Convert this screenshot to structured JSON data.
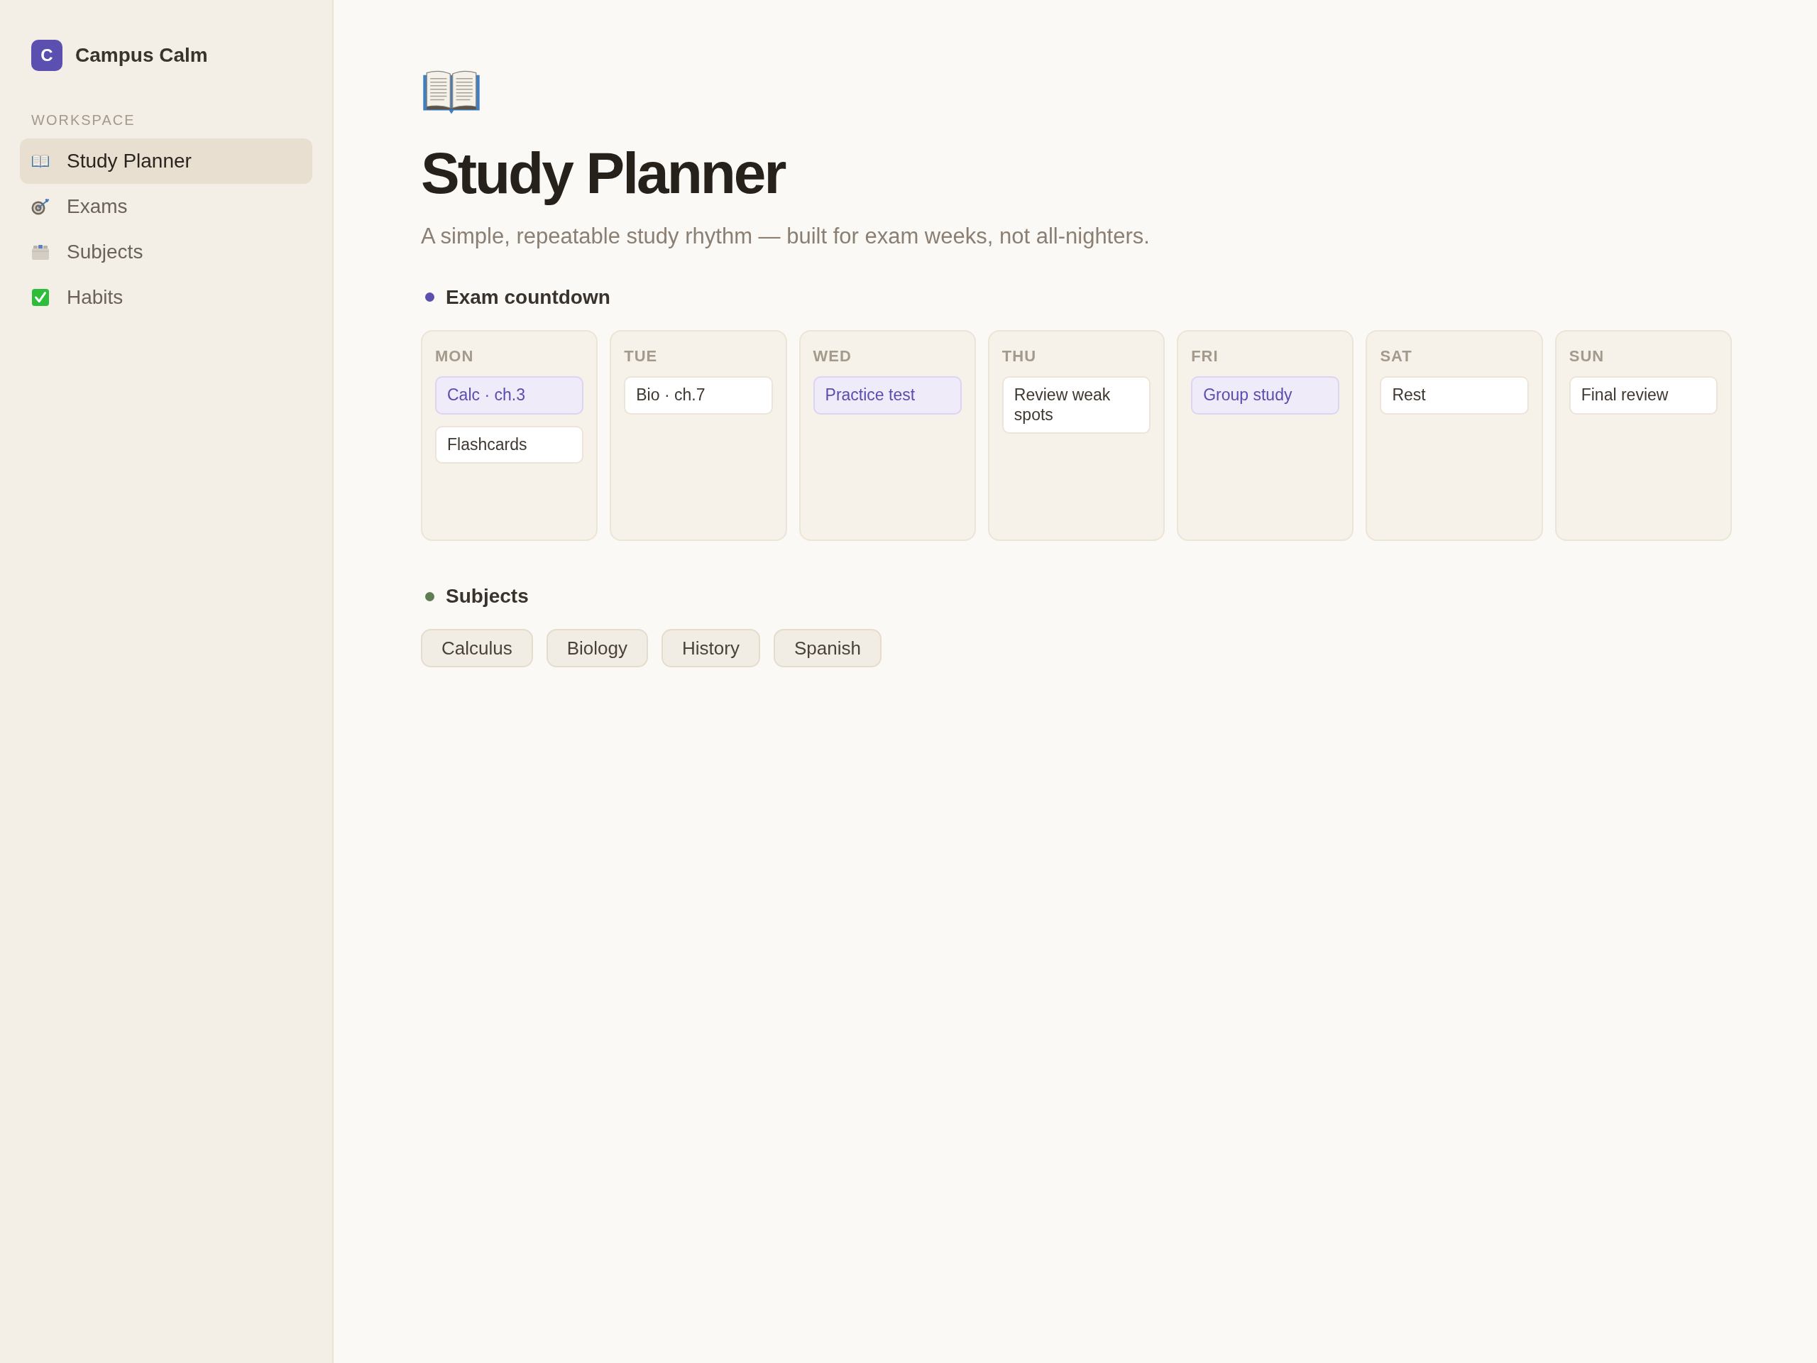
{
  "sidebar": {
    "brand": {
      "logo_letter": "C",
      "name": "Campus Calm"
    },
    "section_label": "WORKSPACE",
    "items": [
      {
        "label": "Study Planner",
        "selected": true
      },
      {
        "label": "Exams",
        "selected": false
      },
      {
        "label": "Subjects",
        "selected": false
      },
      {
        "label": "Habits",
        "selected": false
      }
    ]
  },
  "page": {
    "title": "Study Planner",
    "subtitle": "A simple, repeatable study rhythm — built for exam weeks, not all-nighters."
  },
  "sections": [
    {
      "kind": "week",
      "heading": "Exam countdown",
      "color": "#5b4fb0",
      "days": [
        {
          "label": "MON",
          "events": [
            {
              "text": "Calc · ch.3",
              "color": "#efebf9"
            },
            {
              "text": "Flashcards",
              "color": "#ffffff"
            }
          ]
        },
        {
          "label": "TUE",
          "events": [
            {
              "text": "Bio · ch.7",
              "color": "#ffffff"
            }
          ]
        },
        {
          "label": "WED",
          "events": [
            {
              "text": "Practice test",
              "color": "#efebf9"
            }
          ]
        },
        {
          "label": "THU",
          "events": [
            {
              "text": "Review weak spots",
              "color": "#ffffff"
            }
          ]
        },
        {
          "label": "FRI",
          "events": [
            {
              "text": "Group study",
              "color": "#efebf9"
            }
          ]
        },
        {
          "label": "SAT",
          "events": [
            {
              "text": "Rest",
              "color": "#ffffff"
            }
          ]
        },
        {
          "label": "SUN",
          "events": [
            {
              "text": "Final review",
              "color": "#ffffff"
            }
          ]
        }
      ]
    },
    {
      "kind": "tags",
      "heading": "Subjects",
      "color": "#5f7d52",
      "tags": [
        "Calculus",
        "Biology",
        "History",
        "Spanish"
      ]
    }
  ]
}
